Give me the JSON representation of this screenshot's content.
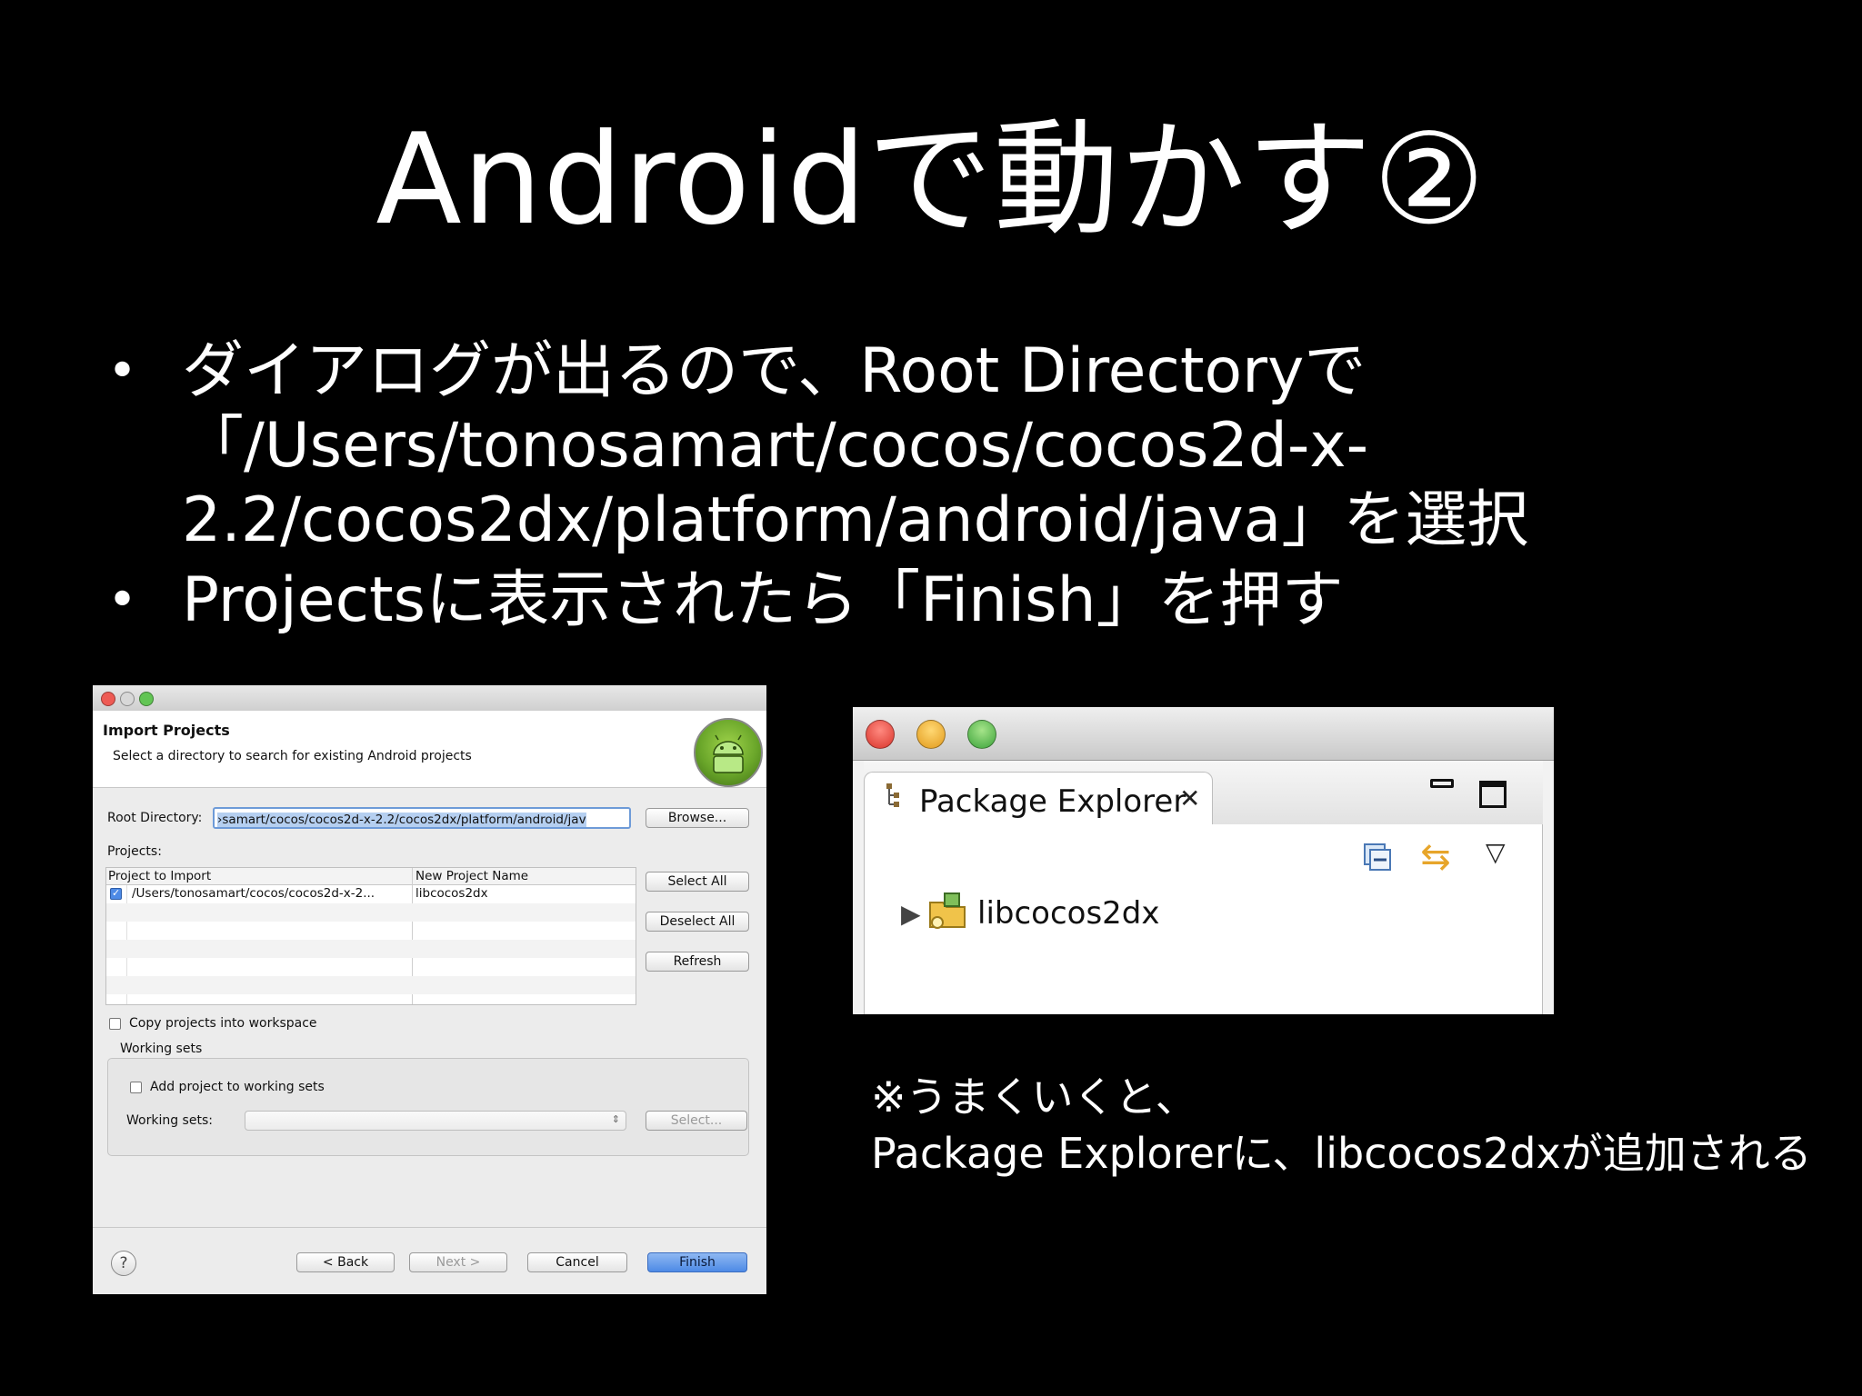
{
  "slide": {
    "title": "Androidで動かす②",
    "bullets": [
      "ダイアログが出るので、Root Directoryで「/Users/tonosamart/cocos/cocos2d-x-2.2/cocos2dx/platform/android/java」を選択",
      "Projectsに表示されたら「Finish」を押す"
    ],
    "note_line1": "※うまくいくと、",
    "note_line2": "Package Explorerに、libcocos2dxが追加される"
  },
  "dialog": {
    "header_title": "Import Projects",
    "header_subtitle": "Select a directory to search for existing Android projects",
    "root_label": "Root Directory:",
    "root_value": "›samart/cocos/cocos2d-x-2.2/cocos2dx/platform/android/jav",
    "browse_button": "Browse...",
    "projects_label": "Projects:",
    "col_project": "Project to Import",
    "col_name": "New Project Name",
    "rows": [
      {
        "path": "/Users/tonosamart/cocos/cocos2d-x-2...",
        "name": "libcocos2dx",
        "checked": true
      }
    ],
    "select_all": "Select All",
    "deselect_all": "Deselect All",
    "refresh": "Refresh",
    "copy_label": "Copy projects into workspace",
    "working_sets_group": "Working sets",
    "add_to_ws_label": "Add project to working sets",
    "ws_label": "Working sets:",
    "ws_select_button": "Select...",
    "back": "< Back",
    "next": "Next >",
    "cancel": "Cancel",
    "finish": "Finish",
    "help": "?"
  },
  "package_explorer": {
    "tab_label": "Package Explorer",
    "close_glyph": "✕",
    "item": "libcocos2dx"
  }
}
